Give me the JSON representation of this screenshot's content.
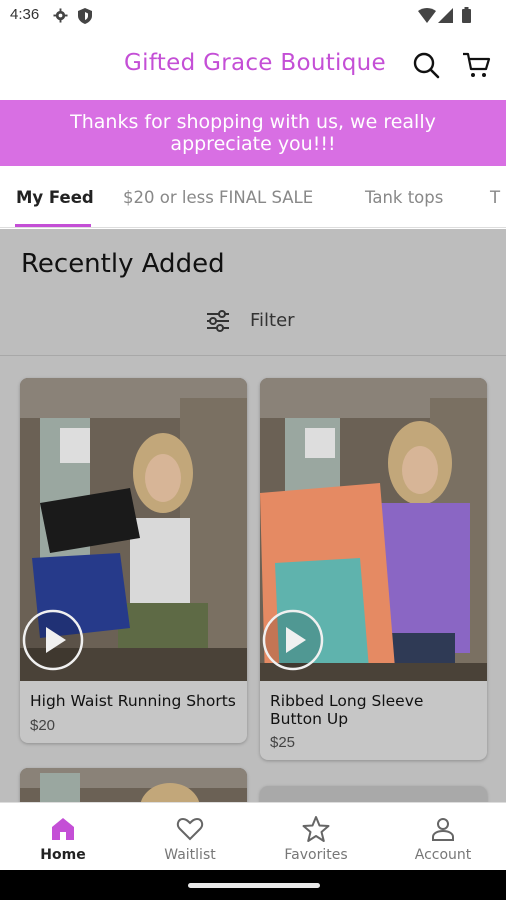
{
  "status_bar": {
    "time": "4:36"
  },
  "header": {
    "title": "Gifted Grace Boutique"
  },
  "banner": {
    "text": "Thanks for shopping with us, we really appreciate you!!!"
  },
  "tabs": [
    {
      "label": "My Feed",
      "active": true
    },
    {
      "label": "$20 or less FINAL SALE"
    },
    {
      "label": "Tank tops"
    },
    {
      "label": "T"
    }
  ],
  "feed": {
    "section_title": "Recently Added",
    "filter_label": "Filter"
  },
  "products": [
    {
      "name": "High Waist Running Shorts",
      "price": "$20"
    },
    {
      "name": "Ribbed Long Sleeve Button Up",
      "price": "$25"
    }
  ],
  "bottom_nav": [
    {
      "label": "Home",
      "icon": "home-icon",
      "active": true
    },
    {
      "label": "Waitlist",
      "icon": "heart-icon"
    },
    {
      "label": "Favorites",
      "icon": "star-icon"
    },
    {
      "label": "Account",
      "icon": "person-icon"
    }
  ],
  "colors": {
    "brand": "#c44fd6",
    "banner": "#d86fe3",
    "feed_bg": "#bdbdbd"
  }
}
